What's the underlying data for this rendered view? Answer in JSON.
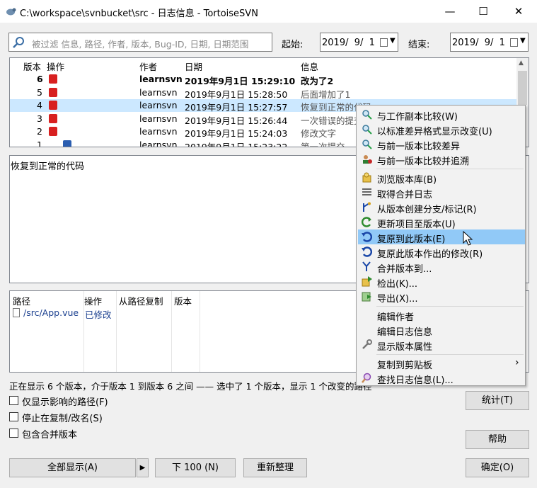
{
  "window": {
    "title": "C:\\workspace\\svnbucket\\src - 日志信息 - TortoiseSVN",
    "minimize": "—",
    "maximize": "☐",
    "close": "✕"
  },
  "filter": {
    "placeholder": "被过滤 信息, 路径, 作者, 版本, Bug-ID, 日期, 日期范围",
    "from_label": "起始:",
    "from_date": "2019/  9/  1",
    "to_label": "结束:",
    "to_date": "2019/  9/  1"
  },
  "log": {
    "headers": [
      "版本",
      "操作",
      "作者",
      "日期",
      "信息"
    ],
    "rows": [
      {
        "rev": "6",
        "author": "learnsvn",
        "date": "2019年9月1日 15:29:10",
        "msg": "改为了2"
      },
      {
        "rev": "5",
        "author": "learnsvn",
        "date": "2019年9月1日 15:28:50",
        "msg": "后面增加了1"
      },
      {
        "rev": "4",
        "author": "learnsvn",
        "date": "2019年9月1日 15:27:57",
        "msg": "恢复到正常的代码"
      },
      {
        "rev": "3",
        "author": "learnsvn",
        "date": "2019年9月1日 15:26:44",
        "msg": "一次错误的提交"
      },
      {
        "rev": "2",
        "author": "learnsvn",
        "date": "2019年9月1日 15:24:03",
        "msg": "修改文字"
      },
      {
        "rev": "1",
        "author": "learnsvn",
        "date": "2019年9月1日 15:23:22",
        "msg": "第一次提交"
      }
    ]
  },
  "message_text": "恢复到正常的代码",
  "paths": {
    "headers": [
      "路径",
      "操作",
      "从路径复制",
      "版本"
    ],
    "file": "/src/App.vue",
    "action": "已修改"
  },
  "status": "正在显示 6 个版本，介于版本 1 到版本 6 之间 —— 选中了 1 个版本，显示 1 个改变的路径",
  "checkboxes": [
    "仅显示影响的路径(F)",
    "停止在复制/改名(S)",
    "包含合并版本"
  ],
  "buttons": {
    "show_all": "全部显示(A)",
    "next": "下 100 (N)",
    "refresh": "重新整理",
    "stats": "统计(T)",
    "help": "帮助",
    "ok": "确定(O)"
  },
  "menu": {
    "items": [
      {
        "label": "与工作副本比较(W)",
        "icon": "magnifier-icon"
      },
      {
        "label": "以标准差异格式显示改变(U)",
        "icon": "magnifier-icon"
      },
      {
        "label": "与前一版本比较差异",
        "icon": "magnifier-icon"
      },
      {
        "label": "与前一版本比较并追溯",
        "icon": "person-icon"
      },
      {
        "label": "浏览版本库(B)",
        "icon": "repo-icon"
      },
      {
        "label": "取得合并日志",
        "icon": "lines-icon"
      },
      {
        "label": "从版本创建分支/标记(R)",
        "icon": "branch-icon"
      },
      {
        "label": "更新项目至版本(U)",
        "icon": "update-icon"
      },
      {
        "label": "复原到此版本(E)",
        "icon": "revert-icon"
      },
      {
        "label": "复原此版本作出的修改(R)",
        "icon": "revert-icon"
      },
      {
        "label": "合并版本到...",
        "icon": "merge-icon"
      },
      {
        "label": "检出(K)...",
        "icon": "checkout-icon"
      },
      {
        "label": "导出(X)...",
        "icon": "export-icon"
      },
      {
        "label": "编辑作者",
        "icon": ""
      },
      {
        "label": "编辑日志信息",
        "icon": ""
      },
      {
        "label": "显示版本属性",
        "icon": "wrench-icon"
      },
      {
        "label": "复制到剪贴板",
        "icon": ""
      },
      {
        "label": "查找日志信息(L)...",
        "icon": "search-icon"
      }
    ],
    "submenu_arrow": "›"
  }
}
